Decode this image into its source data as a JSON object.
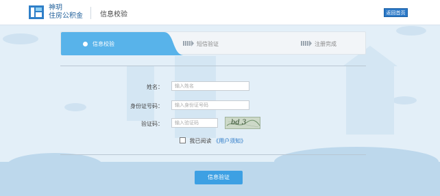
{
  "header": {
    "logo_line1": "神玥",
    "logo_line2": "住房公积金",
    "title": "信息校验",
    "home_button": "返回首页"
  },
  "steps": [
    {
      "label": "信息校验",
      "active": true
    },
    {
      "label": "短信验证",
      "active": false
    },
    {
      "label": "注册完成",
      "active": false
    }
  ],
  "form": {
    "name_label": "姓名：",
    "name_placeholder": "输入姓名",
    "id_label": "身份证号码：",
    "id_placeholder": "输入身份证号码",
    "captcha_label": "验证码：",
    "captcha_placeholder": "输入验证码",
    "captcha_text": "bd 3",
    "agree_prefix": "我已阅读",
    "agree_link": "《用户须知》",
    "submit": "信息验证"
  },
  "colors": {
    "accent": "#58b3ea",
    "brand": "#2a78c7",
    "background": "#e3eff8"
  }
}
